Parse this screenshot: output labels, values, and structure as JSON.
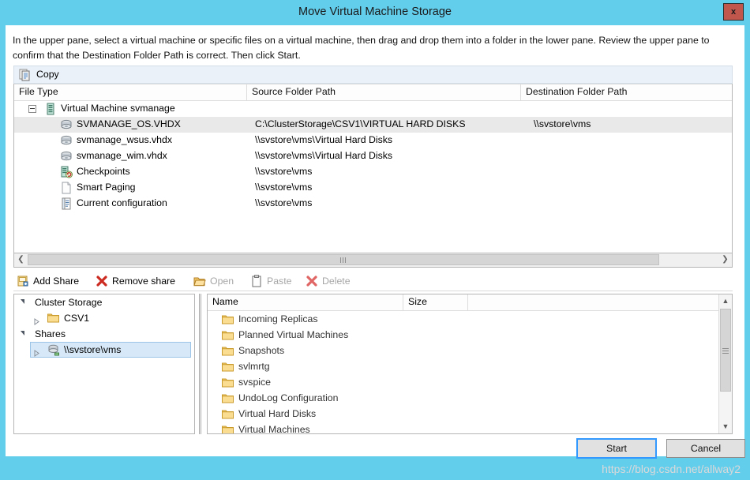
{
  "window": {
    "title": "Move Virtual Machine Storage",
    "close_label": "x",
    "accent_color": "#63cdec",
    "close_button_color": "#c1564d"
  },
  "instructions": "In the upper pane, select a virtual machine or specific files on a virtual machine, then drag and drop them into a folder in the lower pane.  Review the upper pane to confirm that the Destination Folder Path is correct. Then click Start.",
  "copy_bar": {
    "label": "Copy",
    "icon": "copy-icon"
  },
  "upper_grid": {
    "columns": [
      "File Type",
      "Source Folder Path",
      "Destination Folder Path"
    ],
    "rows": [
      {
        "file_type": "Virtual Machine svmanage",
        "source": "",
        "destination": "",
        "depth": 0,
        "icon": "virtual-machine-icon",
        "expanded": true,
        "selected": false
      },
      {
        "file_type": "SVMANAGE_OS.VHDX",
        "source": "C:\\ClusterStorage\\CSV1\\VIRTUAL HARD DISKS",
        "destination": "\\\\svstore\\vms",
        "depth": 1,
        "icon": "hard-disk-icon",
        "expanded": false,
        "selected": true
      },
      {
        "file_type": "svmanage_wsus.vhdx",
        "source": "\\\\svstore\\vms\\Virtual Hard Disks",
        "destination": "",
        "depth": 1,
        "icon": "hard-disk-icon",
        "expanded": false,
        "selected": false
      },
      {
        "file_type": "svmanage_wim.vhdx",
        "source": "\\\\svstore\\vms\\Virtual Hard Disks",
        "destination": "",
        "depth": 1,
        "icon": "hard-disk-icon",
        "expanded": false,
        "selected": false
      },
      {
        "file_type": "Checkpoints",
        "source": "\\\\svstore\\vms",
        "destination": "",
        "depth": 1,
        "icon": "checkpoint-icon",
        "expanded": false,
        "selected": false
      },
      {
        "file_type": "Smart Paging",
        "source": "\\\\svstore\\vms",
        "destination": "",
        "depth": 1,
        "icon": "page-icon",
        "expanded": false,
        "selected": false
      },
      {
        "file_type": "Current configuration",
        "source": "\\\\svstore\\vms",
        "destination": "",
        "depth": 1,
        "icon": "configuration-icon",
        "expanded": false,
        "selected": false
      }
    ]
  },
  "share_toolbar": {
    "items": [
      {
        "label": "Add Share",
        "icon": "add-share-icon",
        "enabled": true
      },
      {
        "label": "Remove share",
        "icon": "remove-share-icon",
        "enabled": true
      },
      {
        "label": "Open",
        "icon": "open-folder-icon",
        "enabled": false
      },
      {
        "label": "Paste",
        "icon": "paste-icon",
        "enabled": false
      },
      {
        "label": "Delete",
        "icon": "delete-icon",
        "enabled": false
      }
    ]
  },
  "tree_pane": {
    "nodes": [
      {
        "label": "Cluster Storage",
        "depth": 0,
        "expanded": true,
        "icon": "",
        "selected": false
      },
      {
        "label": "CSV1",
        "depth": 1,
        "expanded": false,
        "icon": "folder-icon",
        "selected": false
      },
      {
        "label": "Shares",
        "depth": 0,
        "expanded": true,
        "icon": "",
        "selected": false
      },
      {
        "label": "\\\\svstore\\vms",
        "depth": 1,
        "expanded": false,
        "icon": "network-share-icon",
        "selected": true
      }
    ]
  },
  "list_pane": {
    "columns": [
      "Name",
      "Size",
      ""
    ],
    "rows": [
      {
        "name": "Incoming Replicas",
        "size": "",
        "icon": "folder-icon"
      },
      {
        "name": "Planned Virtual Machines",
        "size": "",
        "icon": "folder-icon"
      },
      {
        "name": "Snapshots",
        "size": "",
        "icon": "folder-icon"
      },
      {
        "name": "svlmrtg",
        "size": "",
        "icon": "folder-icon"
      },
      {
        "name": "svspice",
        "size": "",
        "icon": "folder-icon"
      },
      {
        "name": "UndoLog Configuration",
        "size": "",
        "icon": "folder-icon"
      },
      {
        "name": "Virtual Hard Disks",
        "size": "",
        "icon": "folder-icon"
      },
      {
        "name": "Virtual Machines",
        "size": "",
        "icon": "folder-icon"
      }
    ]
  },
  "footer": {
    "start_label": "Start",
    "cancel_label": "Cancel"
  },
  "watermark": "https://blog.csdn.net/allway2"
}
